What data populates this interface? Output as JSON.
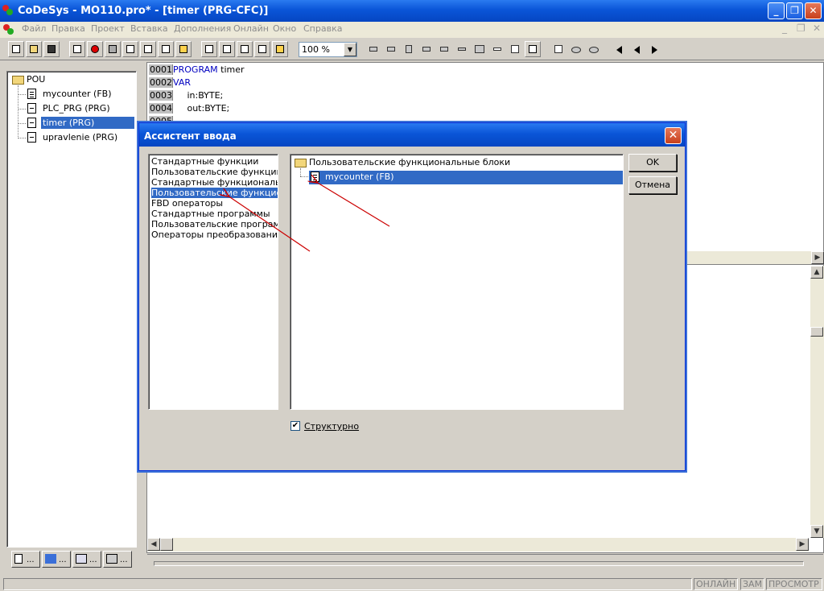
{
  "window": {
    "title": "CoDeSys - MO110.pro* - [timer (PRG-CFC)]",
    "min": "_",
    "restore": "❐",
    "close": "✕"
  },
  "menubar": [
    "Файл",
    "Правка",
    "Проект",
    "Вставка",
    "Дополнения",
    "Онлайн",
    "Окно",
    "Справка"
  ],
  "mdi_controls": [
    "_",
    "❐",
    "✕"
  ],
  "toolbar": {
    "zoom_value": "100 %"
  },
  "pou": {
    "root": "POU",
    "items": [
      {
        "label": "mycounter (FB)",
        "selected": false
      },
      {
        "label": "PLC_PRG (PRG)",
        "selected": false
      },
      {
        "label": "timer (PRG)",
        "selected": true
      },
      {
        "label": "upravlenie (PRG)",
        "selected": false
      }
    ],
    "tabs": [
      "...",
      "...",
      "...",
      "..."
    ]
  },
  "editor": {
    "lines": [
      {
        "num": "0001",
        "kw": "PROGRAM",
        "rest": " timer"
      },
      {
        "num": "0002",
        "kw": "VAR",
        "rest": ""
      },
      {
        "num": "0003",
        "kw": "",
        "rest": "     in:BYTE;"
      },
      {
        "num": "0004",
        "kw": "",
        "rest": "     out:BYTE;"
      },
      {
        "num": "0005",
        "kw": "",
        "rest": ""
      }
    ]
  },
  "dialog": {
    "title": "Ассистент ввода",
    "close": "✕",
    "categories": [
      "Стандартные функции",
      "Пользовательские функции",
      "Стандартные функциональные",
      "Пользовательские функциона",
      "FBD операторы",
      "Стандартные программы",
      "Пользовательские программы",
      "Операторы преобразования"
    ],
    "selected_category_index": 3,
    "tree_root": "Пользовательские функциональные блоки",
    "tree_item": "mycounter (FB)",
    "ok": "OK",
    "cancel": "Отмена",
    "structured_label": "Структурно",
    "structured_checked": "✔"
  },
  "status": [
    "ОНЛАЙН",
    "ЗАМ",
    "ПРОСМОТР"
  ],
  "colors": {
    "titlebar": "#0a55d8",
    "selection": "#316ac5",
    "arrow": "#cc0000",
    "keyword": "#0000c0"
  }
}
